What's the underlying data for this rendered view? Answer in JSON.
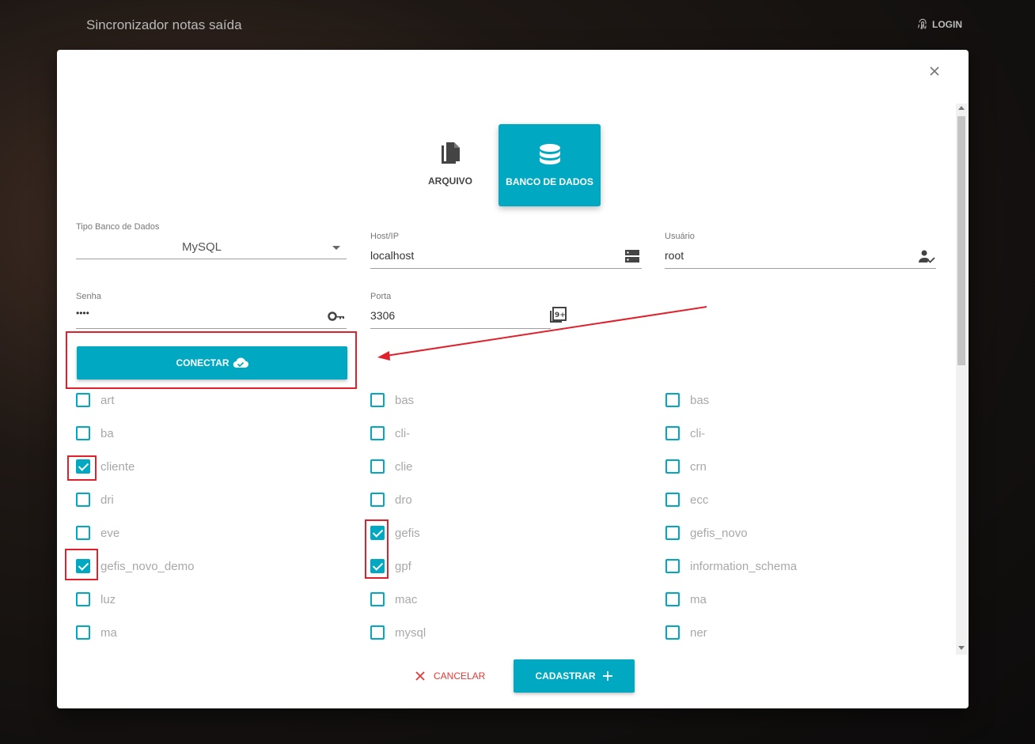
{
  "app": {
    "title": "Sincronizador notas saída",
    "login_label": "LOGIN"
  },
  "modal": {
    "tabs": [
      {
        "label": "ARQUIVO",
        "icon": "file-copy-icon",
        "active": false
      },
      {
        "label": "BANCO DE DADOS",
        "icon": "database-icon",
        "active": true
      }
    ],
    "fields": {
      "db_type": {
        "label": "Tipo Banco de Dados",
        "value": "MySQL"
      },
      "host": {
        "label": "Host/IP",
        "value": "localhost",
        "icon": "server-icon"
      },
      "user": {
        "label": "Usuário",
        "value": "root",
        "icon": "person-check-icon"
      },
      "password": {
        "label": "Senha",
        "value": "••••",
        "icon": "key-icon"
      },
      "port": {
        "label": "Porta",
        "value": "3306",
        "icon": "filter-9-plus-icon"
      }
    },
    "connect_label": "CONECTAR",
    "databases": [
      {
        "name": "art",
        "checked": false
      },
      {
        "name": "bas",
        "checked": false
      },
      {
        "name": "bas",
        "checked": false
      },
      {
        "name": "ba",
        "checked": false
      },
      {
        "name": "cli-",
        "checked": false
      },
      {
        "name": "cli-",
        "checked": false
      },
      {
        "name": "cliente",
        "checked": true
      },
      {
        "name": "clie",
        "checked": false
      },
      {
        "name": "crn",
        "checked": false
      },
      {
        "name": "dri",
        "checked": false
      },
      {
        "name": "dro",
        "checked": false
      },
      {
        "name": "ecc",
        "checked": false
      },
      {
        "name": "eve",
        "checked": false
      },
      {
        "name": "gefis",
        "checked": true
      },
      {
        "name": "gefis_novo",
        "checked": false
      },
      {
        "name": "gefis_novo_demo",
        "checked": true
      },
      {
        "name": "gpf",
        "checked": true
      },
      {
        "name": "information_schema",
        "checked": false
      },
      {
        "name": "luz",
        "checked": false
      },
      {
        "name": "mac",
        "checked": false
      },
      {
        "name": "ma",
        "checked": false
      },
      {
        "name": "ma",
        "checked": false
      },
      {
        "name": "mysql",
        "checked": false
      },
      {
        "name": "ner",
        "checked": false
      }
    ],
    "cancel_label": "CANCELAR",
    "submit_label": "CADASTRAR"
  },
  "colors": {
    "accent": "#00a9c1",
    "danger": "#e53935",
    "highlight": "#e0202a"
  }
}
